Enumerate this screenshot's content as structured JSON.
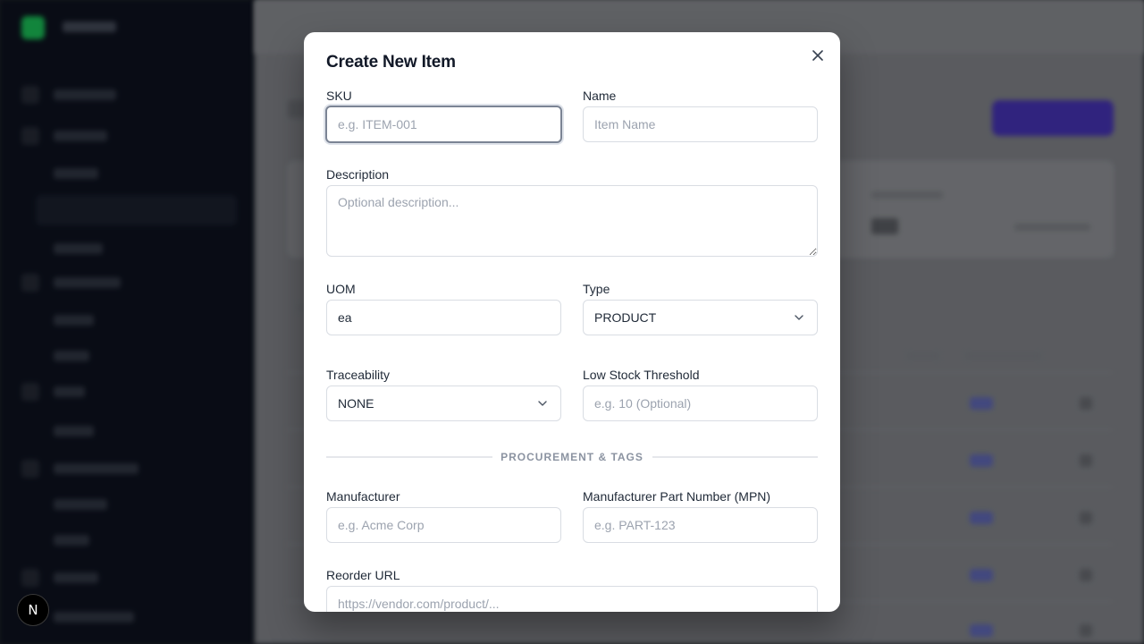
{
  "modal": {
    "title": "Create New Item",
    "close_icon": "close-icon"
  },
  "form": {
    "sku": {
      "label": "SKU",
      "placeholder": "e.g. ITEM-001",
      "value": ""
    },
    "name": {
      "label": "Name",
      "placeholder": "Item Name",
      "value": ""
    },
    "description": {
      "label": "Description",
      "placeholder": "Optional description..."
    },
    "uom": {
      "label": "UOM",
      "value": "ea"
    },
    "type": {
      "label": "Type",
      "value": "PRODUCT",
      "icon": "chevron-down-icon"
    },
    "traceability": {
      "label": "Traceability",
      "value": "NONE",
      "icon": "chevron-down-icon"
    },
    "low_stock": {
      "label": "Low Stock Threshold",
      "placeholder": "e.g. 10 (Optional)"
    },
    "section": {
      "label": "PROCUREMENT & TAGS"
    },
    "manufacturer": {
      "label": "Manufacturer",
      "placeholder": "e.g. Acme Corp"
    },
    "mpn": {
      "label": "Manufacturer Part Number (MPN)",
      "placeholder": "e.g. PART-123"
    },
    "reorder_url": {
      "label": "Reorder URL",
      "placeholder": "https://vendor.com/product/..."
    }
  },
  "dev_badge": {
    "label": "N"
  },
  "colors": {
    "focus_ring": "#7b8494",
    "brand_button": "#3b2b9a",
    "sidebar_bg": "#0b0f1a"
  }
}
